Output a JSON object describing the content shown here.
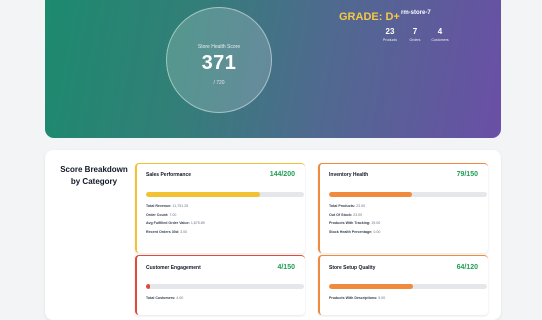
{
  "hero": {
    "score_label": "Store Health Score",
    "score": "371",
    "score_max": "/ 720",
    "grade": "GRADE: D+",
    "store_name": "rm-store-7",
    "stats": [
      {
        "value": "23",
        "label": "Products"
      },
      {
        "value": "7",
        "label": "Orders"
      },
      {
        "value": "4",
        "label": "Customers"
      }
    ]
  },
  "breakdown": {
    "title": "Score Breakdown by Category",
    "cards": [
      {
        "name": "Sales Performance",
        "score": "144/200",
        "percent": 72,
        "color": "#f2c232",
        "metrics": [
          {
            "label": "Total Revenue:",
            "value": "11,751.25"
          },
          {
            "label": "Order Count:",
            "value": "7.00"
          },
          {
            "label": "Avg Fulfilled Order Value:",
            "value": "1,675.89"
          },
          {
            "label": "Recent Orders 30d:",
            "value": "3.00"
          }
        ]
      },
      {
        "name": "Inventory Health",
        "score": "79/150",
        "percent": 52.7,
        "color": "#f08a3c",
        "metrics": [
          {
            "label": "Total Products:",
            "value": "23.00"
          },
          {
            "label": "Out Of Stock:",
            "value": "23.00"
          },
          {
            "label": "Products With Tracking:",
            "value": "19.00"
          },
          {
            "label": "Stock Health Percentage:",
            "value": "0.00"
          }
        ]
      },
      {
        "name": "Customer Engagement",
        "score": "4/150",
        "percent": 2.7,
        "color": "#e04a3b",
        "metrics": [
          {
            "label": "Total Customers:",
            "value": "4.00"
          }
        ]
      },
      {
        "name": "Store Setup Quality",
        "score": "64/120",
        "percent": 53.3,
        "color": "#f08a3c",
        "metrics": [
          {
            "label": "Products With Descriptions:",
            "value": "5.00"
          }
        ]
      }
    ]
  },
  "colors": {
    "score_green": "#1f9d55",
    "grade_gold": "#f6c744"
  }
}
